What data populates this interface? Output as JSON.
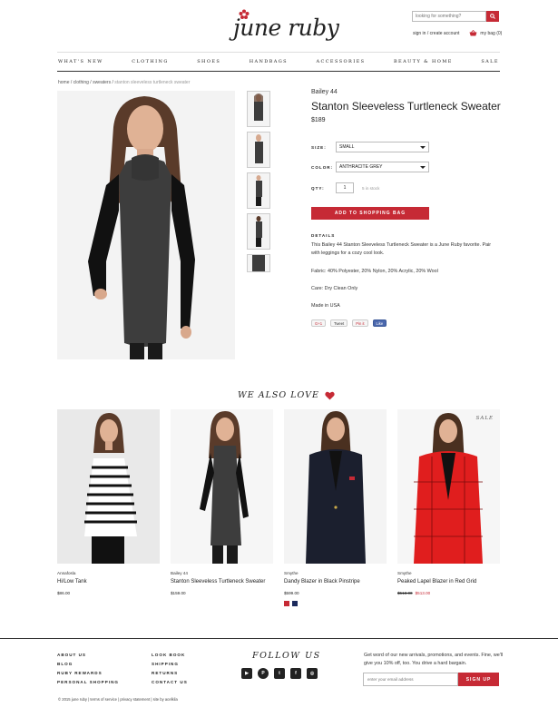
{
  "header": {
    "logo_text": "june ruby",
    "search_placeholder": "looking for something?",
    "signin_label": "sign in / create account",
    "bag_label": "my bag (0)",
    "accent_color": "#c62a35"
  },
  "nav": [
    "WHAT'S NEW",
    "CLOTHING",
    "SHOES",
    "HANDBAGS",
    "ACCESSORIES",
    "BEAUTY & HOME",
    "SALE"
  ],
  "breadcrumb": {
    "path": "home / clothing / sweaters / ",
    "current": "stanton sleeveless turtleneck sweater"
  },
  "product": {
    "brand": "Bailey 44",
    "title": "Stanton Sleeveless Turtleneck Sweater",
    "price": "$189",
    "size_label": "SIZE:",
    "size_value": "SMALL",
    "color_label": "COLOR:",
    "color_value": "ANTHRACITE GREY",
    "qty_label": "QTY:",
    "qty_value": "1",
    "stock": "5 in stock",
    "add_to_bag": "ADD TO SHOPPING BAG",
    "details_label": "DETAILS",
    "description": "This Bailey 44 Stanton Sleeveless Turtleneck Sweater is a June Ruby favorite. Pair with leggings for a cozy cool look.",
    "fabric": "Fabric: 40% Polyester, 20% Nylon, 20% Acrylic, 20% Wool",
    "care": "Care: Dry Clean Only",
    "origin": "Made in USA",
    "share": {
      "gplus": "G+1",
      "tweet": "Tweet",
      "pin": "Pin it",
      "like": "Like"
    }
  },
  "recommendations": {
    "heading": "WE ALSO LOVE",
    "items": [
      {
        "brand": "Annafosla",
        "name": "Hi/Low Tank",
        "price": "$86.00",
        "tag": ""
      },
      {
        "brand": "Bailey 44",
        "name": "Stanton Sleeveless Turtleneck Sweater",
        "price": "$159.00",
        "tag": ""
      },
      {
        "brand": "Smythe",
        "name": "Dandy Blazer in Black Pinstripe",
        "price": "$599.00",
        "tag": "",
        "swatches": [
          "#c62a35",
          "#1b2a5c"
        ]
      },
      {
        "brand": "Smythe",
        "name": "Peaked Lapel Blazer in Red Grid",
        "price": "$513.00",
        "sale_price": "$513.00",
        "tag": "SALE"
      }
    ]
  },
  "footer": {
    "col1": [
      "ABOUT US",
      "BLOG",
      "RUBY REWARDS",
      "PERSONAL SHOPPING"
    ],
    "col2": [
      "LOOK BOOK",
      "SHIPPING",
      "RETURNS",
      "CONTACT US"
    ],
    "follow_heading": "FOLLOW US",
    "socials": [
      "youtube-icon",
      "pinterest-icon",
      "twitter-icon",
      "facebook-icon",
      "instagram-icon"
    ],
    "newsletter_text": "Get word of our new arrivals, promotions, and events. Fine, we'll give you 10% off, too. You drive a hard bargain.",
    "email_placeholder": "enter your email address",
    "signup_label": "SIGN UP",
    "legal": "© 2015 june ruby  |  terms of service  |  privacy statement  |  site by acelkila"
  }
}
